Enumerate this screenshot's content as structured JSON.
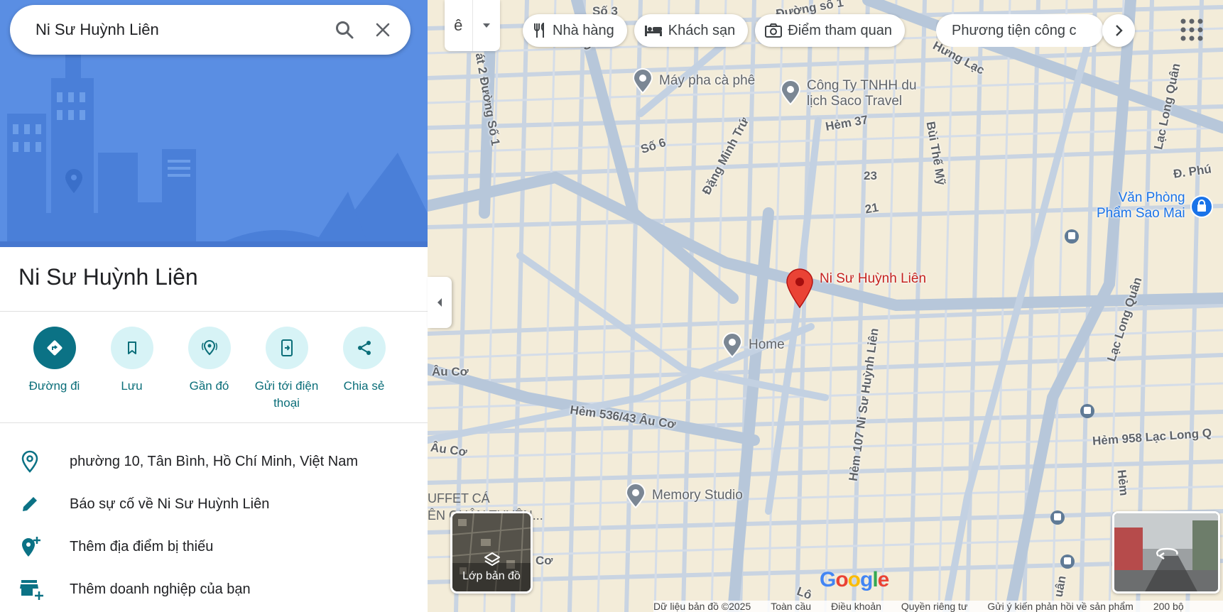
{
  "search": {
    "value": "Ni Sư Huỳnh Liên",
    "search_icon": "search-icon",
    "close_icon": "close-icon"
  },
  "place": {
    "title": "Ni Sư Huỳnh Liên"
  },
  "actions": [
    {
      "label": "Đường đi",
      "icon": "directions-icon"
    },
    {
      "label": "Lưu",
      "icon": "bookmark-icon"
    },
    {
      "label": "Gần đó",
      "icon": "nearby-icon"
    },
    {
      "label": "Gửi tới điện thoại",
      "icon": "send-to-phone-icon"
    },
    {
      "label": "Chia sẻ",
      "icon": "share-icon"
    }
  ],
  "info": [
    {
      "text": "phường 10, Tân Bình, Hồ Chí Minh, Việt Nam",
      "icon": "location-pin-icon"
    },
    {
      "text": "Báo sự cố về Ni Sư Huỳnh Liên",
      "icon": "pencil-icon"
    },
    {
      "text": "Thêm địa điểm bị thiếu",
      "icon": "add-location-icon"
    },
    {
      "text": "Thêm doanh nghiệp của bạn",
      "icon": "add-business-icon"
    }
  ],
  "input_tools": {
    "label": "ê"
  },
  "chips": [
    {
      "label": "Nhà hàng",
      "icon": "restaurant-icon"
    },
    {
      "label": "Khách sạn",
      "icon": "hotel-icon"
    },
    {
      "label": "Điểm tham quan",
      "icon": "camera-icon"
    },
    {
      "label": "Phương tiện công c",
      "icon": "transit-icon"
    }
  ],
  "map": {
    "selected_place": "Ni Sư Huỳnh Liên",
    "pois": {
      "may_pha": "Máy pha cà phê",
      "saco_1": "Công Ty TNHH du",
      "saco_2": "lịch Saco Travel",
      "home": "Home",
      "memory": "Memory Studio",
      "vanphong_1": "Văn Phòng",
      "vanphong_2": "Phẩm Sao Mai",
      "buffet_1": "UFFET CÁ",
      "buffet_2": "ÊN QUẬN TUYÊN..."
    },
    "roads": {
      "so3": "Số 3",
      "so4": "Số 4",
      "duongso1": "Đường số 1",
      "cat2": "át 2 Đường Số 1",
      "so6": "Số 6",
      "dangminhtru": "Đặng Minh Trứ",
      "hem37": "Hẻm 37",
      "buithemy": "Bùi Thế Mỹ",
      "n23": "23",
      "n21": "21",
      "hunglac": "Hưng Lạc",
      "laclongquan1": "Lạc Long Quân",
      "laclongquan2": "Lạc Long Quân",
      "dphu": "Đ. Phú",
      "auco1": "Âu Cơ",
      "auco2": "Âu Cơ",
      "hem536": "Hẻm 536/43 Âu Cơ",
      "hem107": "Hẻm 107 Ni Sư Huỳnh Liên",
      "hem958": "Hẻm 958 Lạc Long Q",
      "hem": "Hẻm",
      "co": "Cơ",
      "lo": "Lô",
      "uan": "uân"
    }
  },
  "layers": {
    "label": "Lớp bản đồ",
    "icon": "layers-icon"
  },
  "footer": {
    "items": [
      "Dữ liệu bản đồ ©2025",
      "Toàn cầu",
      "Điều khoản",
      "Quyền riêng tư",
      "Gửi ý kiến phản hồi về sản phẩm",
      "200 bộ"
    ]
  },
  "brand": {
    "logo": "Google",
    "accent": "#0b7285",
    "pin_color": "#ea4335"
  }
}
